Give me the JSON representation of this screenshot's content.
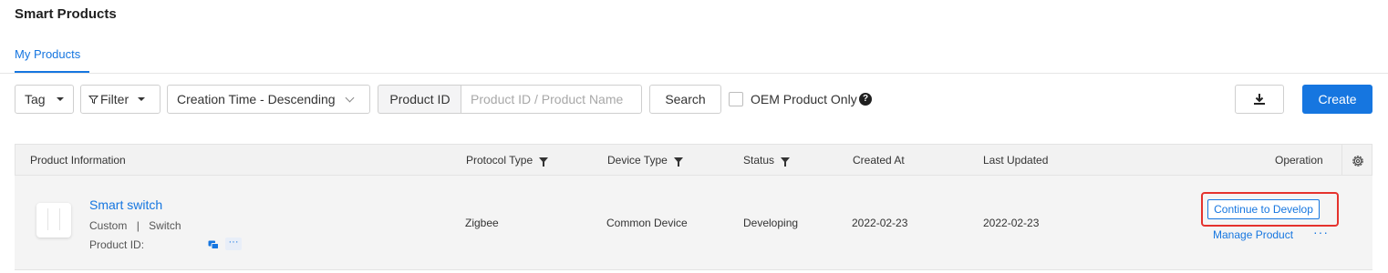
{
  "page": {
    "title": "Smart Products"
  },
  "tabs": [
    {
      "label": "My Products",
      "active": true
    }
  ],
  "toolbar": {
    "tag_label": "Tag",
    "filter_label": "Filter",
    "sort_value": "Creation Time - Descending",
    "search_type": "Product ID",
    "search_placeholder": "Product ID / Product Name",
    "search_value": "",
    "search_button": "Search",
    "oem_label": "OEM Product Only",
    "oem_checked": false,
    "help_icon": "?",
    "download_icon": "download-icon",
    "create_label": "Create"
  },
  "table": {
    "columns": {
      "product_info": "Product Information",
      "protocol_type": "Protocol Type",
      "device_type": "Device Type",
      "status": "Status",
      "created_at": "Created At",
      "last_updated": "Last Updated",
      "operation": "Operation"
    },
    "rows": [
      {
        "name": "Smart switch",
        "category": "Custom",
        "separator": "|",
        "subcategory": "Switch",
        "product_id_label": "Product ID:",
        "product_id_value": "",
        "protocol_type": "Zigbee",
        "device_type": "Common Device",
        "status": "Developing",
        "created_at": "2022-02-23",
        "last_updated": "2022-02-23",
        "primary_action": "Continue to Develop",
        "secondary_action": "Manage Product",
        "more_label": "···"
      }
    ]
  },
  "colors": {
    "accent": "#1676e0",
    "highlight": "#e5322d",
    "header_bg": "#f2f2f2"
  }
}
